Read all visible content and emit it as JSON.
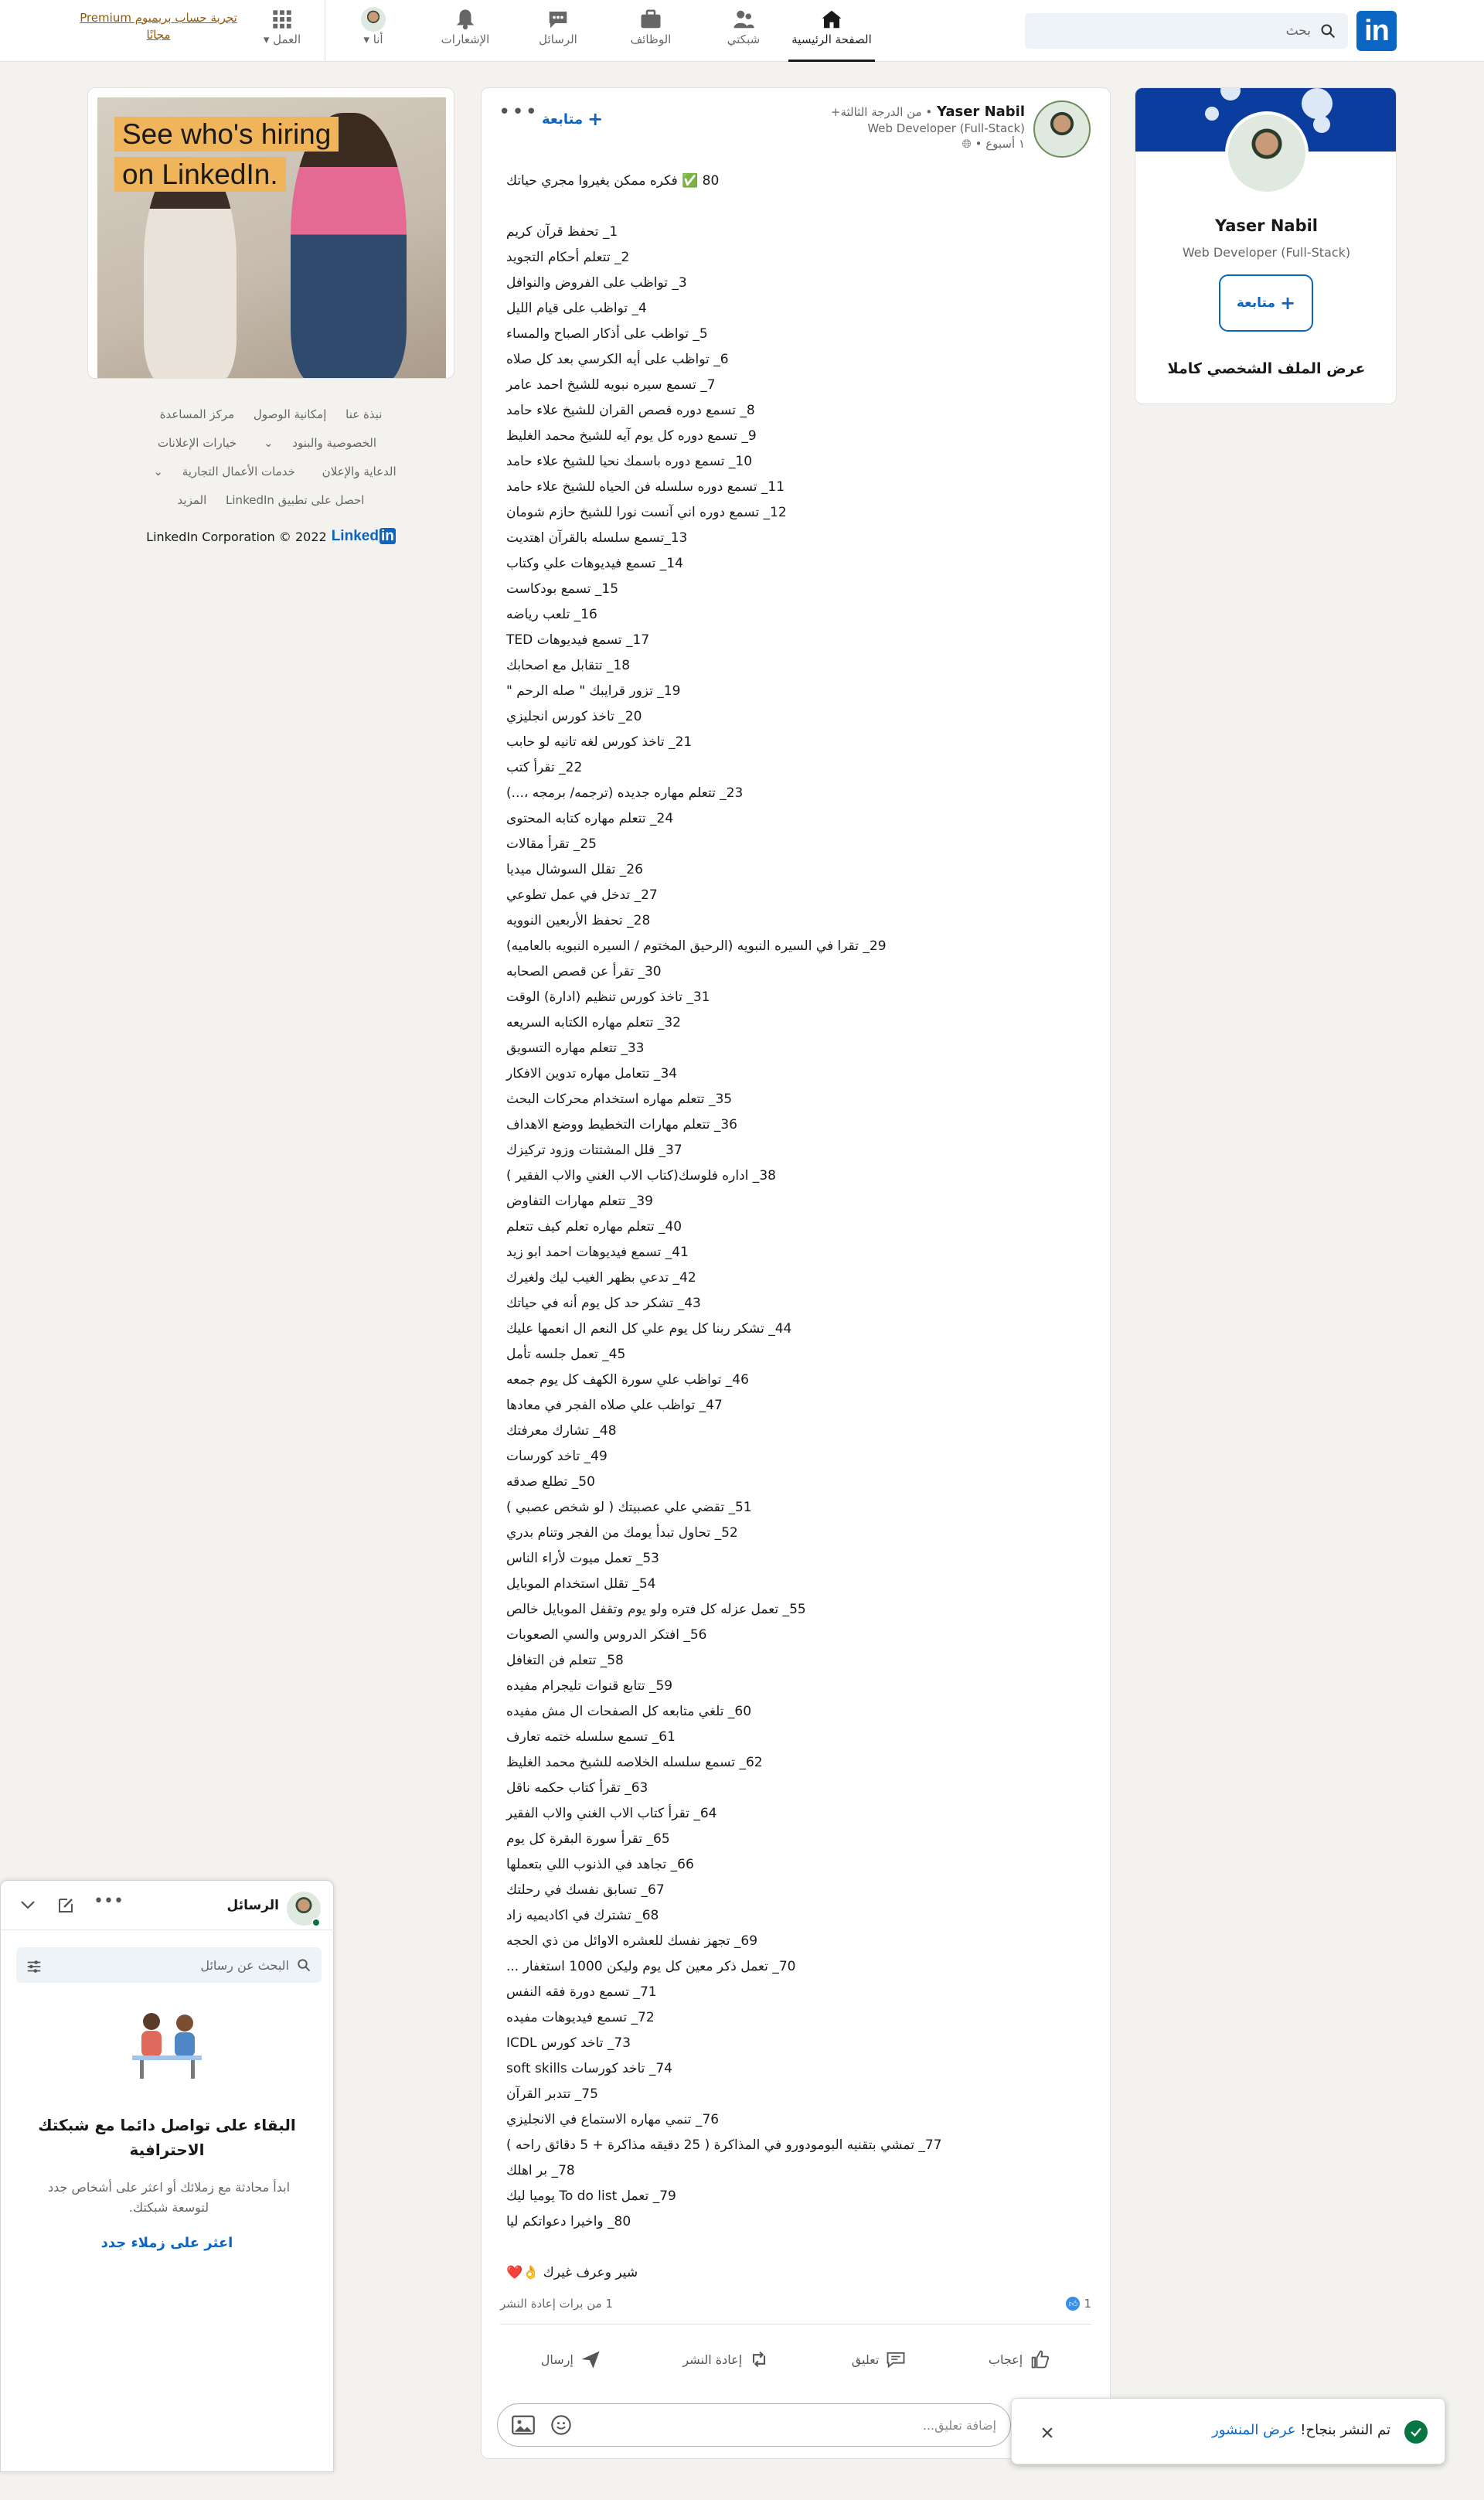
{
  "nav": {
    "logo": "in",
    "search_placeholder": "بحث",
    "items": [
      {
        "label": "الصفحة الرئيسية",
        "icon": "home-icon"
      },
      {
        "label": "شبكتي",
        "icon": "network-icon"
      },
      {
        "label": "الوظائف",
        "icon": "jobs-icon"
      },
      {
        "label": "الرسائل",
        "icon": "messaging-icon"
      },
      {
        "label": "الإشعارات",
        "icon": "bell-icon"
      },
      {
        "label": "أنا",
        "icon": "avatar"
      },
      {
        "label": "العمل",
        "icon": "grid-icon"
      }
    ],
    "premium": "تجربة حساب بريميوم Premium مجانًا"
  },
  "profile_card": {
    "name": "Yaser Nabil",
    "headline": "Web Developer (Full-Stack)",
    "follow_label": "متابعة",
    "view_full": "عرض الملف الشخصي كاملا"
  },
  "post": {
    "author": "Yaser Nabil",
    "degree": "• من الدرجة الثالثة+",
    "headline": "Web Developer (Full-Stack)",
    "time": "١ أسبوع •",
    "follow_label": "متابعة",
    "more": "•••",
    "intro": "80 ✅ فكره ممكن يغيروا مجري حياتك",
    "lines": [
      "1_ تحفظ قرآن كريم",
      "2_ تتعلم أحكام التجويد",
      "3_ تواظب على الفروض والنوافل",
      "4_ تواظب على قيام الليل",
      "5_ تواظب على أذكار الصباح والمساء",
      "6_ تواظب على أيه الكرسي بعد كل صلاه",
      "7_ تسمع سيره نبويه للشيخ احمد عامر",
      "8_ تسمع دوره قصص القران للشيخ علاء حامد",
      "9_ تسمع دوره كل يوم آيه للشيخ محمد الغليظ",
      "10_ تسمع دوره باسمك نحيا للشيخ علاء حامد",
      "11_ تسمع دوره سلسله فن الحياه للشيخ علاء حامد",
      "12_ تسمع دوره اني آنست نورا للشيخ حازم شومان",
      "13_تسمع سلسله بالقرآن اهتديت",
      "14_ تسمع فيديوهات علي وكتاب",
      "15_ تسمع بودكاست",
      "16_ تلعب رياضه",
      "17_ تسمع فيديوهات TED",
      "18_ تتقابل مع اصحابك",
      "19_ تزور قرايبك \" صله الرحم \"",
      "20_ تاخذ كورس انجليزي",
      "21_ تاخذ كورس لغه تانيه لو حابب",
      "22_ تقرأ كتب",
      "23_ تتعلم مهاره جديده (ترجمه/ برمجه ،...)",
      "24_ تتعلم مهاره كتابه المحتوى",
      "25_ تقرأ مقالات",
      "26_ تقلل السوشال ميديا",
      "27_ تدخل في عمل تطوعي",
      "28_ تحفظ الأربعين النوويه",
      "29_ تقرا في السيره النبويه (الرحيق المختوم / السيره النبويه بالعاميه)",
      "30_ تقرأ عن قصص الصحابه",
      "31_ تاخذ كورس تنظيم (ادارة) الوقت",
      "32_ تتعلم مهاره الكتابه السريعه",
      "33_ تتعلم مهاره التسويق",
      "34_ تتعامل مهاره تدوين الافكار",
      "35_ تتعلم مهاره استخدام محركات البحث",
      "36_ تتعلم مهارات التخطيط ووضع الاهداف",
      "37_ قلل المشتتات وزود تركيزك",
      "38_ اداره فلوسك(كتاب الاب الغني والاب الفقير )",
      "39_ تتعلم مهارات التفاوض",
      "40_ تتعلم مهاره تعلم كيف تتعلم",
      "41_ تسمع فيديوهات احمد ابو زيد",
      "42_ تدعي بظهر الغيب ليك ولغيرك",
      "43_ تشكر حد كل يوم أنه في حياتك",
      "44_ تشكر ربنا كل يوم علي كل النعم ال انعمها عليك",
      "45_ تعمل جلسه تأمل",
      "46_ تواظب علي سورة الكهف كل يوم جمعه",
      "47_ تواظب علي صلاه الفجر في معادها",
      "48_ تشارك معرفتك",
      "49_ تاخد كورسات",
      "50_ تطلع صدقه",
      "51_ تقضي علي عصبيتك ( لو شخص عصبي )",
      "52_ تحاول تبدأ يومك من الفجر وتنام بدري",
      "53_ تعمل ميوت لأراء الناس",
      "54_ تقلل استخدام الموبايل",
      "55_ تعمل عزله كل فتره ولو يوم وتقفل الموبايل خالص",
      "56_ افتكر الدروس والسي الصعوبات",
      "58_ تتعلم فن التغافل",
      "59_ تتابع قنوات تليجرام مفيده",
      "60_ تلغي متابعه كل الصفحات ال مش مفيده",
      "61_ تسمع سلسله ختمه تعارف",
      "62_ تسمع سلسله الخلاصه للشيخ محمد الغليظ",
      "63_ تقرأ كتاب حكمه ناقل",
      "64_ تقرأ كتاب الاب الغني والاب الفقير",
      "65_ تقرأ سورة البقرة كل يوم",
      "66_ تجاهد في الذنوب اللي بتعملها",
      "67_ تسابق نفسك في رحلتك",
      "68_ تشترك في اكاديميه زاد",
      "69_ تجهز نفسك للعشره الاوائل من ذي الحجه",
      "70_ تعمل ذكر معين كل يوم وليكن 1000 استغفار ...",
      "71_ تسمع دورة فقه النفس",
      "72_ تسمع فيديوهات مفيده",
      "73_ تاخد كورس ICDL",
      "74_ تاخد كورسات soft skills",
      "75_ تتدبر القرآن",
      "76_ تنمي مهاره الاستماع في الانجليزي",
      "77_ تمشي بتقنيه البومودورو في المذاكرة ( 25 دقيقه مذاكرة + 5 دقائق راحه )",
      "78_ بر اهلك",
      "79_ تعمل To do list يوميا ليك",
      "80_ واخيرا دعواتكم ليا"
    ],
    "outro": "شير وعرف غيرك 👌❤️",
    "likes_count": "1",
    "reposts_text": "1 من برات إعادة النشر",
    "actions": [
      {
        "label": "إعجاب",
        "icon": "like-icon"
      },
      {
        "label": "تعليق",
        "icon": "comment-icon"
      },
      {
        "label": "إعادة النشر",
        "icon": "repost-icon"
      },
      {
        "label": "إرسال",
        "icon": "send-icon"
      }
    ],
    "comment_placeholder": "إضافة تعليق..."
  },
  "ad": {
    "line1": "See who's hiring",
    "line2": "on LinkedIn."
  },
  "footer": {
    "links": [
      "نبذة عنا",
      "إمكانية الوصول",
      "مركز المساعدة",
      "الخصوصية والبنود",
      "خيارات الإعلانات",
      "الدعاية والإعلان",
      "خدمات الأعمال التجارية",
      "احصل على تطبيق LinkedIn",
      "المزيد"
    ],
    "copyright": "LinkedIn Corporation © 2022",
    "brand": "Linked",
    "brand_in": "in"
  },
  "messaging": {
    "title": "الرسائل",
    "search_placeholder": "البحث عن رسائل",
    "empty_title": "البقاء على تواصل دائما مع شبكتك الاحترافية",
    "empty_sub": "ابدأ محادثة مع زملائك أو اعثر على أشخاص جدد لتوسعة شبكتك.",
    "find_label": "اعثر على زملاء جدد"
  },
  "toast": {
    "text": "تم النشر بنجاح!",
    "link": "عرض المنشور"
  },
  "colors": {
    "accent": "#0a66c2",
    "success": "#057642",
    "premium": "#915907"
  }
}
